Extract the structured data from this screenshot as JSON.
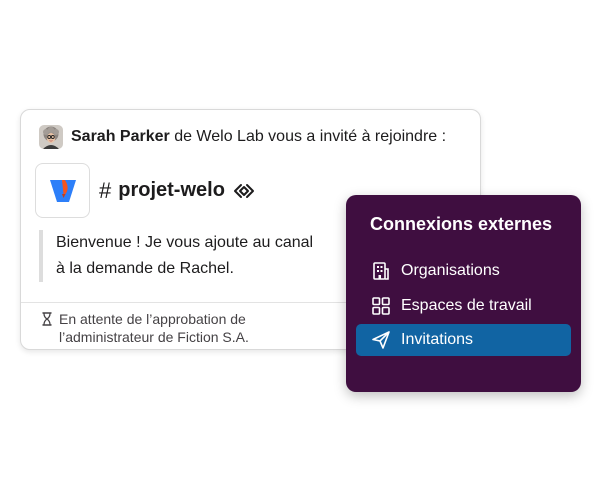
{
  "invite": {
    "sender_name": "Sarah Parker",
    "sender_rest": "de Welo Lab vous a invité à rejoindre :",
    "channel_hash": "#",
    "channel_name": "projet-welo",
    "message_lines": [
      "Bienvenue ! Je vous ajoute au canal",
      "à la demande de Rachel."
    ],
    "pending_lines": [
      "En attente de l’approbation de",
      "l’administrateur de Fiction S.A."
    ]
  },
  "panel": {
    "title": "Connexions externes",
    "items": [
      {
        "label": "Organisations",
        "icon": "building-icon",
        "active": false
      },
      {
        "label": "Espaces de travail",
        "icon": "grid-icon",
        "active": false
      },
      {
        "label": "Invitations",
        "icon": "paper-plane-icon",
        "active": true
      }
    ]
  },
  "colors": {
    "panel_bg": "#3f0e40",
    "active_item": "#1164a3",
    "logo_blue": "#2d7ff9",
    "logo_orange": "#f5541f"
  }
}
